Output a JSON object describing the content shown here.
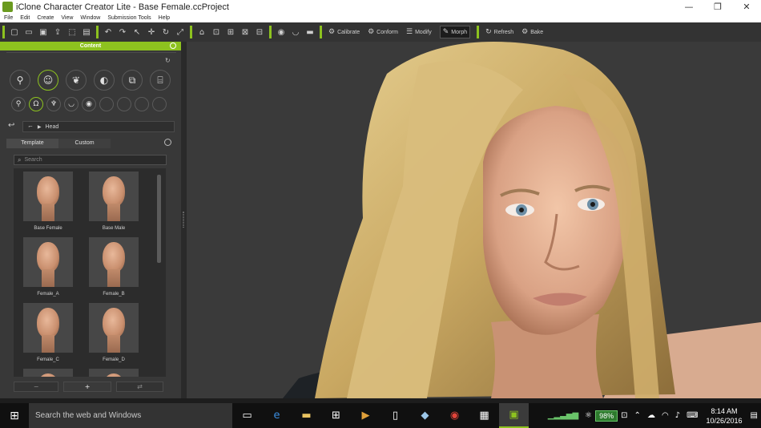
{
  "window": {
    "title": "iClone Character Creator Lite - Base Female.ccProject",
    "controls": [
      "—",
      "❐",
      "✕"
    ]
  },
  "menu": [
    "File",
    "Edit",
    "Create",
    "View",
    "Window",
    "Submission Tools",
    "Help"
  ],
  "toolbar": {
    "calibrate": "Calibrate",
    "conform": "Conform",
    "modify": "Modify",
    "morph": "Morph",
    "refresh": "Refresh",
    "bake": "Bake"
  },
  "content_panel": {
    "header": "Content",
    "breadcrumb_path": "Head",
    "tabs": [
      "Template",
      "Custom"
    ],
    "active_tab": "Template",
    "search_placeholder": "Search",
    "items": [
      {
        "label": "Base Female"
      },
      {
        "label": "Base Male"
      },
      {
        "label": "Female_A"
      },
      {
        "label": "Female_B"
      },
      {
        "label": "Female_C"
      },
      {
        "label": "Female_D"
      }
    ],
    "add_button": "+"
  },
  "taskbar": {
    "search_placeholder": "Search the web and Windows",
    "battery": "98%",
    "time": "8:14 AM",
    "date": "10/26/2016"
  },
  "colors": {
    "accent": "#8dc21f",
    "panel_bg": "#383838",
    "viewport_bg": "#3a3a3a"
  }
}
